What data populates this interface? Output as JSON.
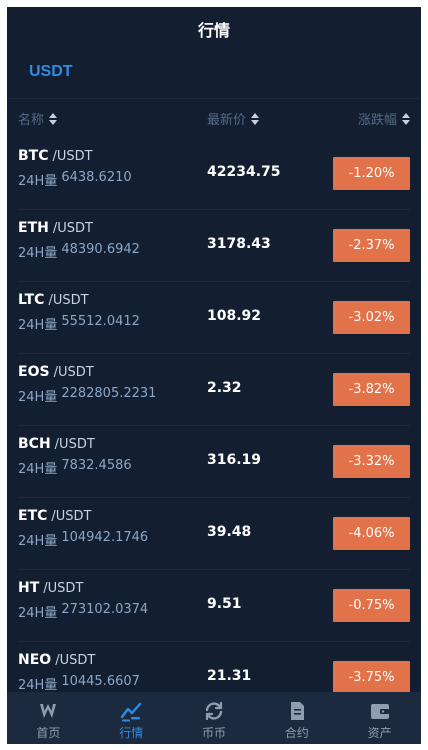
{
  "header": {
    "title": "行情"
  },
  "market_tab": "USDT",
  "columns": {
    "name": "名称",
    "price": "最新价",
    "change": "涨跌幅"
  },
  "rows": [
    {
      "symbol": "BTC",
      "quote": "/USDT",
      "volume_label": "24H量",
      "volume": "6438.6210",
      "price": "42234.75",
      "change": "-1.20%"
    },
    {
      "symbol": "ETH",
      "quote": "/USDT",
      "volume_label": "24H量",
      "volume": "48390.6942",
      "price": "3178.43",
      "change": "-2.37%"
    },
    {
      "symbol": "LTC",
      "quote": "/USDT",
      "volume_label": "24H量",
      "volume": "55512.0412",
      "price": "108.92",
      "change": "-3.02%"
    },
    {
      "symbol": "EOS",
      "quote": "/USDT",
      "volume_label": "24H量",
      "volume": "2282805.2231",
      "price": "2.32",
      "change": "-3.82%"
    },
    {
      "symbol": "BCH",
      "quote": "/USDT",
      "volume_label": "24H量",
      "volume": "7832.4586",
      "price": "316.19",
      "change": "-3.32%"
    },
    {
      "symbol": "ETC",
      "quote": "/USDT",
      "volume_label": "24H量",
      "volume": "104942.1746",
      "price": "39.48",
      "change": "-4.06%"
    },
    {
      "symbol": "HT",
      "quote": "/USDT",
      "volume_label": "24H量",
      "volume": "273102.0374",
      "price": "9.51",
      "change": "-0.75%"
    },
    {
      "symbol": "NEO",
      "quote": "/USDT",
      "volume_label": "24H量",
      "volume": "10445.6607",
      "price": "21.31",
      "change": "-3.75%"
    }
  ],
  "tabbar": [
    {
      "label": "首页",
      "icon": "home-logo-icon"
    },
    {
      "label": "行情",
      "icon": "market-chart-icon",
      "active": true
    },
    {
      "label": "币币",
      "icon": "exchange-icon"
    },
    {
      "label": "合约",
      "icon": "contract-icon"
    },
    {
      "label": "资产",
      "icon": "wallet-icon"
    }
  ],
  "colors": {
    "background": "#131f30",
    "accent": "#2f8be6",
    "down": "#e2724a",
    "muted": "#566a86"
  }
}
